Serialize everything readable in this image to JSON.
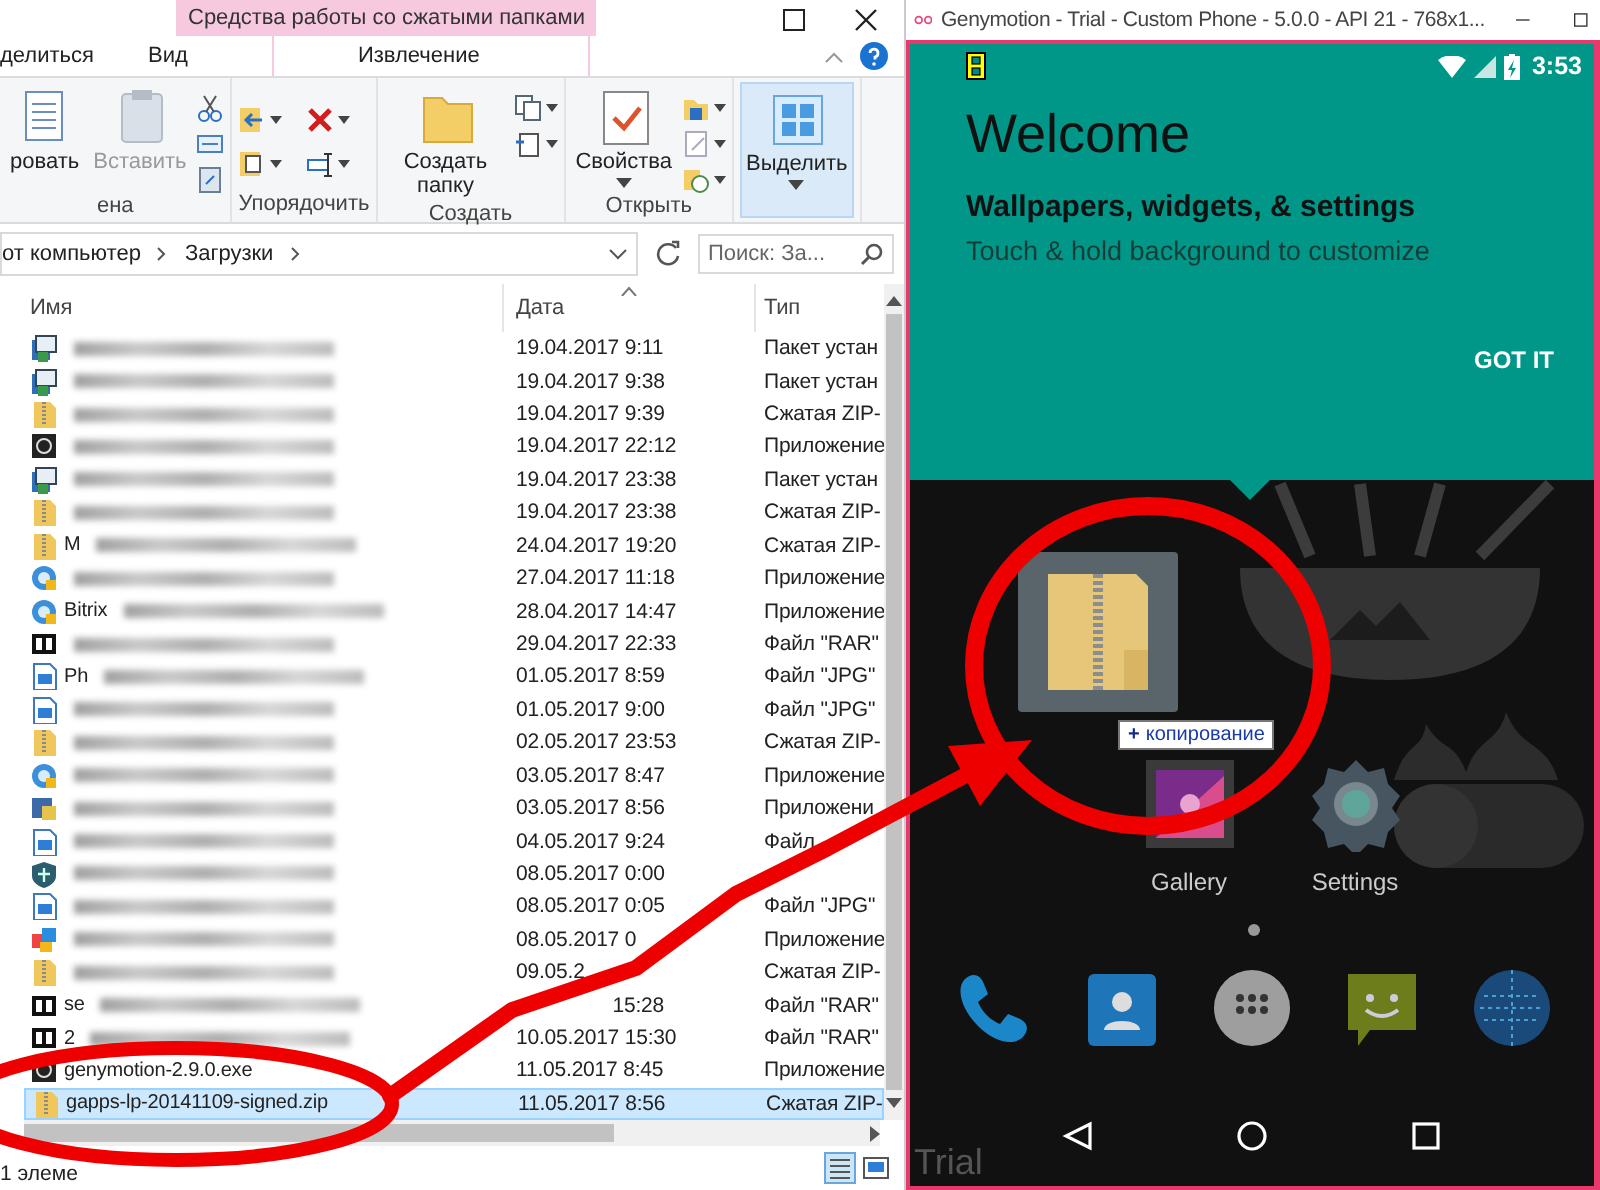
{
  "explorer": {
    "context_header": "Средства работы со сжатыми папками",
    "tabs": [
      {
        "label": "делиться",
        "selected": false
      },
      {
        "label": "Вид",
        "selected": false
      },
      {
        "label": "Извлечение",
        "selected": false
      }
    ],
    "ribbon_groups": [
      {
        "label": "ена",
        "buttons": [
          {
            "label": "ровать",
            "disabled": false,
            "dropdown": false,
            "selected": false
          },
          {
            "label": "Вставить",
            "disabled": true,
            "dropdown": false,
            "selected": false
          }
        ]
      },
      {
        "label": "Упорядочить"
      },
      {
        "label": "Создать",
        "buttons": [
          {
            "label": "Создать папку",
            "disabled": false,
            "dropdown": false,
            "selected": false
          }
        ]
      },
      {
        "label": "Открыть",
        "buttons": [
          {
            "label": "Свойства",
            "disabled": false,
            "dropdown": true,
            "selected": false
          }
        ]
      },
      {
        "buttons": [
          {
            "label": "Выделить",
            "disabled": false,
            "dropdown": true,
            "selected": true
          }
        ]
      }
    ],
    "path": [
      "от компьютер",
      "Загрузки"
    ],
    "search": {
      "placeholder": "Поиск: За..."
    },
    "columns": [
      {
        "label": "Имя",
        "sorted": false
      },
      {
        "label": "Дата",
        "sorted": true
      },
      {
        "label": "Тип",
        "sorted": false
      }
    ],
    "rows": [
      {
        "kind": "msi",
        "blurred": true,
        "date": "19.04.2017 9:11",
        "type": "Пакет устан",
        "selected": false
      },
      {
        "kind": "msi",
        "blurred": true,
        "date": "19.04.2017 9:38",
        "type": "Пакет устан",
        "selected": false
      },
      {
        "kind": "zip",
        "blurred": true,
        "date": "19.04.2017 9:39",
        "type": "Сжатая ZIP-",
        "selected": false
      },
      {
        "kind": "exe",
        "blurred": true,
        "date": "19.04.2017 22:12",
        "type": "Приложение",
        "selected": false
      },
      {
        "kind": "msi",
        "blurred": true,
        "date": "19.04.2017 23:38",
        "type": "Пакет устан",
        "selected": false
      },
      {
        "kind": "zip",
        "blurred": true,
        "date": "19.04.2017 23:38",
        "type": "Сжатая ZIP-",
        "selected": false
      },
      {
        "kind": "zip",
        "name": "M",
        "blurred": true,
        "date": "24.04.2017 19:20",
        "type": "Сжатая ZIP-",
        "selected": false
      },
      {
        "kind": "app",
        "blurred": true,
        "date": "27.04.2017 11:18",
        "type": "Приложение",
        "selected": false
      },
      {
        "kind": "app",
        "name": "Bitrix",
        "blurred": true,
        "date": "28.04.2017 14:47",
        "type": "Приложение",
        "selected": false
      },
      {
        "kind": "rar",
        "blurred": true,
        "date": "29.04.2017 22:33",
        "type": "Файл \"RAR\"",
        "selected": false
      },
      {
        "kind": "jpg",
        "name": "Ph",
        "blurred": true,
        "date": "01.05.2017 8:59",
        "type": "Файл \"JPG\"",
        "selected": false
      },
      {
        "kind": "jpg",
        "blurred": true,
        "date": "01.05.2017 9:00",
        "type": "Файл \"JPG\"",
        "selected": false
      },
      {
        "kind": "zip",
        "blurred": true,
        "date": "02.05.2017 23:53",
        "type": "Сжатая ZIP-",
        "selected": false
      },
      {
        "kind": "app",
        "blurred": true,
        "date": "03.05.2017 8:47",
        "type": "Приложение",
        "selected": false
      },
      {
        "kind": "setup",
        "blurred": true,
        "date": "03.05.2017 8:56",
        "type": "Приложени",
        "selected": false
      },
      {
        "kind": "jpg",
        "blurred": true,
        "date": "04.05.2017 9:24",
        "type": "Файл",
        "selected": false
      },
      {
        "kind": "shield",
        "blurred": true,
        "date": "08.05.2017 0:00",
        "selected": false
      },
      {
        "kind": "jpg",
        "blurred": true,
        "date": "08.05.2017 0:05",
        "type": "Файл \"JPG\"",
        "selected": false
      },
      {
        "kind": "multi",
        "blurred": true,
        "date": "08.05.2017 0",
        "type": "Приложение",
        "selected": false
      },
      {
        "kind": "zip",
        "blurred": true,
        "date": "09.05.2",
        "type": "Сжатая ZIP-",
        "selected": false
      },
      {
        "kind": "rar",
        "name": "se",
        "blurred": true,
        "date_tail": "15:28",
        "type": "Файл \"RAR\"",
        "selected": false
      },
      {
        "kind": "rar",
        "name": "2",
        "blurred": true,
        "date": "10.05.2017 15:30",
        "type": "Файл \"RAR\"",
        "selected": false
      },
      {
        "kind": "exe",
        "name": "genymotion-2.9.0.exe",
        "blurred": false,
        "date": "11.05.2017 8:45",
        "type": "Приложение",
        "selected": false
      },
      {
        "kind": "zip",
        "name": "gapps-lp-20141109-signed.zip",
        "blurred": false,
        "date": "11.05.2017 8:56",
        "type": "Сжатая ZIP-",
        "selected": true
      }
    ],
    "status": "1 элеме"
  },
  "emulator": {
    "title": "Genymotion - Trial - Custom Phone - 5.0.0 - API 21 - 768x1...",
    "time": "3:53",
    "welcome": {
      "title": "Welcome",
      "subtitle": "Wallpapers, widgets, & settings",
      "hint": "Touch & hold background to customize",
      "button": "GOT IT"
    },
    "drag_tooltip": {
      "glyph": "+",
      "label": "копирование"
    },
    "apps": [
      {
        "label": "Gallery"
      },
      {
        "label": "Settings"
      }
    ],
    "page_dots": [
      {
        "selected": true
      }
    ],
    "trial_mark": "Trial"
  }
}
